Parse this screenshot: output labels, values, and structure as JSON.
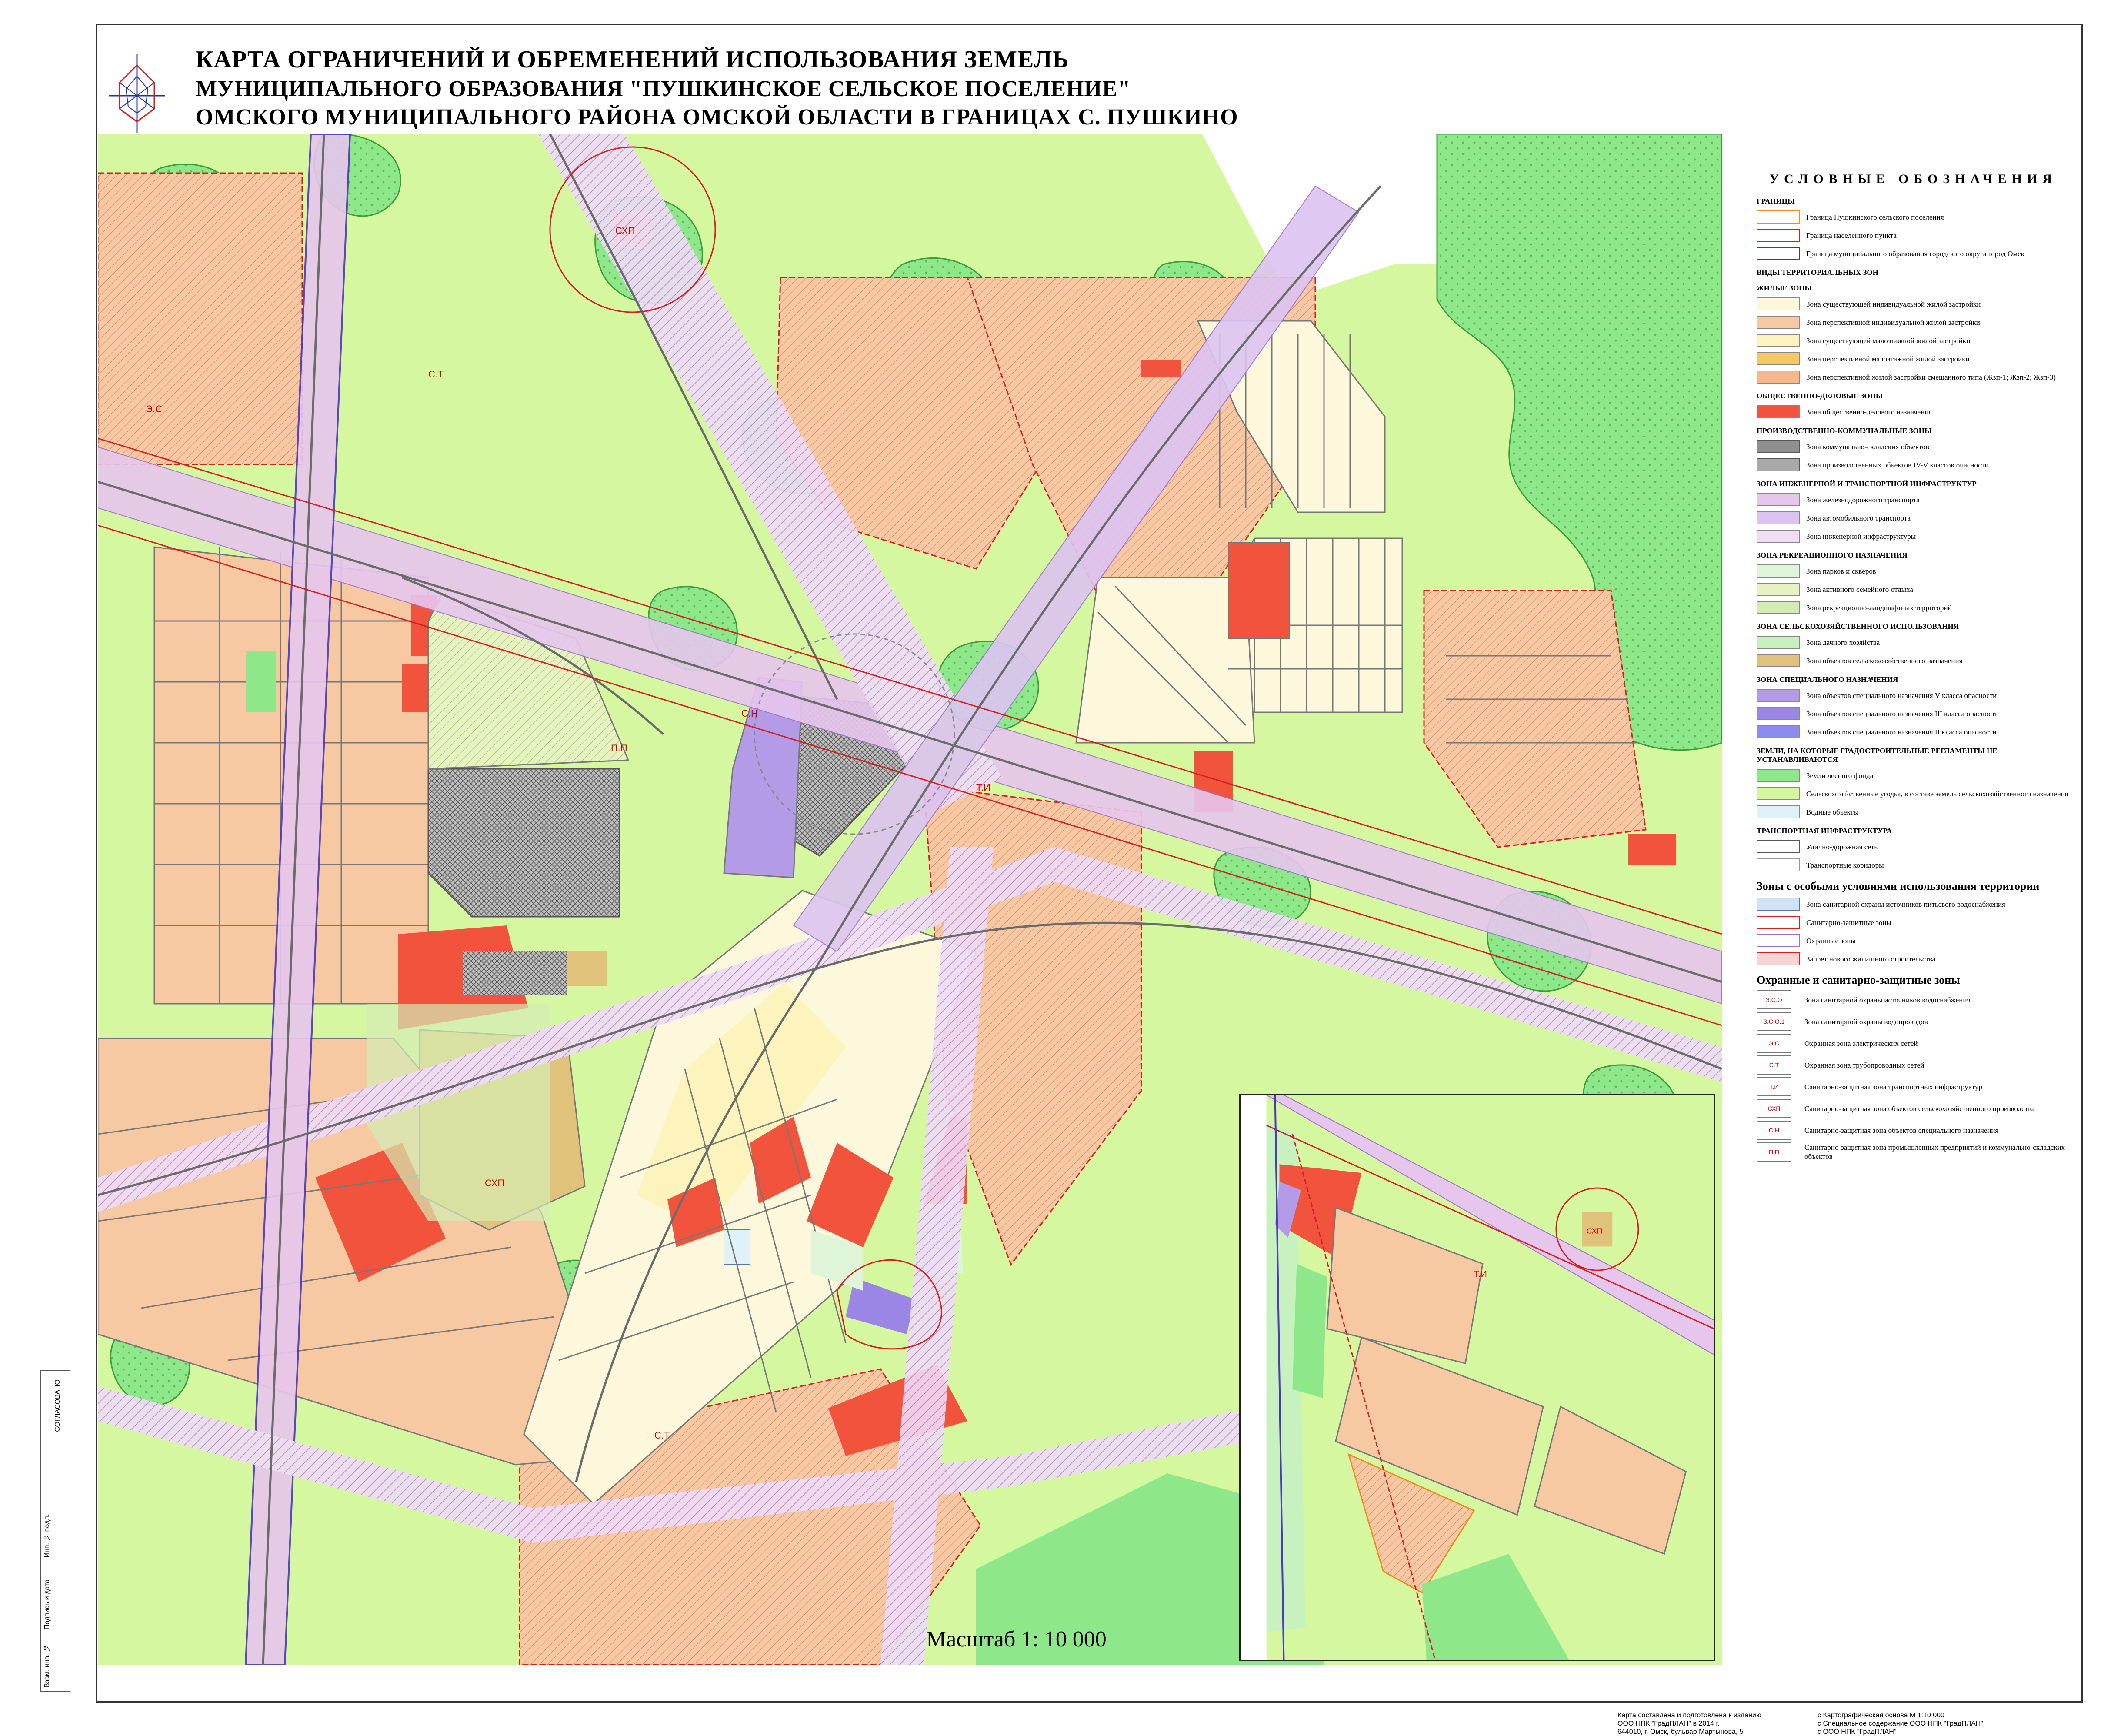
{
  "title": {
    "line1": "КАРТА ОГРАНИЧЕНИЙ И ОБРЕМЕНЕНИЙ ИСПОЛЬЗОВАНИЯ ЗЕМЕЛЬ",
    "line2": "МУНИЦИПАЛЬНОГО ОБРАЗОВАНИЯ \"ПУШКИНСКОЕ СЕЛЬСКОЕ ПОСЕЛЕНИЕ\"",
    "line3": "ОМСКОГО МУНИЦИПАЛЬНОГО РАЙОНА ОМСКОЙ ОБЛАСТИ В ГРАНИЦАХ С. ПУШКИНО"
  },
  "scale": "Масштаб 1: 10 000",
  "map_labels": {
    "skp": "СХП",
    "ti": "Т.И",
    "st": "С.Т",
    "es": "Э.С",
    "sn": "С.Н",
    "pp": "П.П"
  },
  "legend": {
    "title": "УСЛОВНЫЕ ОБОЗНАЧЕНИЯ",
    "sections": [
      {
        "heading": "ГРАНИЦЫ",
        "items": [
          {
            "label": "Граница Пушкинского сельского поселения",
            "fill": "#ffffff",
            "border": "#f08a1a"
          },
          {
            "label": "Граница населенного пункта",
            "fill": "#ffffff",
            "border": "#d21f1f"
          },
          {
            "label": "Граница муниципального образования городского округа город Омск",
            "fill": "#ffffff",
            "border": "#444444"
          }
        ]
      },
      {
        "heading": "ВИДЫ ТЕРРИТОРИАЛЬНЫХ ЗОН",
        "items": []
      },
      {
        "heading": "ЖИЛЫЕ ЗОНЫ",
        "items": [
          {
            "label": "Зона существующей индивидуальной жилой застройки",
            "fill": "#fdf8dc",
            "border": "#888888"
          },
          {
            "label": "Зона перспективной индивидуальной жилой застройки",
            "fill": "#f6c9a3",
            "border": "#888888"
          },
          {
            "label": "Зона существующей малоэтажной жилой застройки",
            "fill": "#fdf3bd",
            "border": "#888888"
          },
          {
            "label": "Зона перспективной малоэтажной жилой застройки",
            "fill": "#f5c765",
            "border": "#888888"
          },
          {
            "label": "Зона перспективной жилой застройки смешанного типа (Жзп-1; Жзп-2; Жзп-3)",
            "fill": "#f8b789",
            "border": "#888888"
          }
        ]
      },
      {
        "heading": "ОБЩЕСТВЕННО-ДЕЛОВЫЕ ЗОНЫ",
        "items": [
          {
            "label": "Зона общественно-делового назначения",
            "fill": "#f2533d",
            "border": "#888888"
          }
        ]
      },
      {
        "heading": "ПРОИЗВОДСТВЕННО-КОММУНАЛЬНЫЕ ЗОНЫ",
        "items": [
          {
            "label": "Зона коммунально-складских объектов",
            "fill": "#8f8f8f",
            "border": "#555555"
          },
          {
            "label": "Зона производственных объектов IV-V классов опасности",
            "fill": "#a9a9a9",
            "border": "#555555"
          }
        ]
      },
      {
        "heading": "ЗОНА ИНЖЕНЕРНОЙ И ТРАНСПОРТНОЙ ИНФРАСТРУКТУР",
        "items": [
          {
            "label": "Зона железнодорожного транспорта",
            "fill": "#e7c6ee",
            "border": "#888888"
          },
          {
            "label": "Зона автомобильного транспорта",
            "fill": "#dcc4f2",
            "border": "#888888"
          },
          {
            "label": "Зона инженерной инфраструктуры",
            "fill": "#efdcf5",
            "border": "#888888"
          }
        ]
      },
      {
        "heading": "ЗОНА РЕКРЕАЦИОННОГО НАЗНАЧЕНИЯ",
        "items": [
          {
            "label": "Зона парков и скверов",
            "fill": "#dff5d8",
            "border": "#888888"
          },
          {
            "label": "Зона активного семейного отдыха",
            "fill": "#e6f2c2",
            "border": "#888888"
          },
          {
            "label": "Зона рекреационно-ландшафтных территорий",
            "fill": "#d4ecb4",
            "border": "#888888"
          }
        ]
      },
      {
        "heading": "ЗОНА СЕЛЬСКОХОЗЯЙСТВЕННОГО ИСПОЛЬЗОВАНИЯ",
        "items": [
          {
            "label": "Зона дачного хозяйства",
            "fill": "#c7f2c0",
            "border": "#888888"
          },
          {
            "label": "Зона объектов сельскохозяйственного назначения",
            "fill": "#e0c27a",
            "border": "#888888"
          }
        ]
      },
      {
        "heading": "ЗОНА СПЕЦИАЛЬНОГО НАЗНАЧЕНИЯ",
        "items": [
          {
            "label": "Зона объектов специального назначения V класса опасности",
            "fill": "#b49be8",
            "border": "#888888"
          },
          {
            "label": "Зона объектов специального назначения III класса опасности",
            "fill": "#9b86e6",
            "border": "#888888"
          },
          {
            "label": "Зона объектов специального назначения II класса опасности",
            "fill": "#8b8cf0",
            "border": "#888888"
          }
        ]
      },
      {
        "heading": "ЗЕМЛИ, НА КОТОРЫЕ ГРАДОСТРОИТЕЛЬНЫЕ РЕГЛАМЕНТЫ НЕ УСТАНАВЛИВАЮТСЯ",
        "items": [
          {
            "label": "Земли лесного фонда",
            "fill": "#8ee88a",
            "border": "#888888"
          },
          {
            "label": "Сельскохозяйственные угодья, в составе земель сельскохозяйственного назначения",
            "fill": "#d5f7a0",
            "border": "#888888"
          },
          {
            "label": "Водные объекты",
            "fill": "#dff2f7",
            "border": "#888888"
          }
        ]
      },
      {
        "heading": "ТРАНСПОРТНАЯ ИНФРАСТРУКТУРА",
        "items": [
          {
            "label": "Улично-дорожная сеть",
            "fill": "#ffffff",
            "border": "#555555"
          },
          {
            "label": "Транспортные коридоры",
            "fill": "#ffffff",
            "border": "#999999"
          }
        ]
      }
    ],
    "special_heading": "Зоны с особыми условиями использования территории",
    "special_items": [
      {
        "label": "Зона санитарной охраны источников питьевого водоснабжения",
        "fill": "#cfe3f5",
        "border": "#5577aa"
      },
      {
        "label": "Санитарно-защитные зоны",
        "fill": "#ffffff",
        "border": "#d21f1f"
      },
      {
        "label": "Охранные зоны",
        "fill": "#ffffff",
        "border": "#9a72c9"
      },
      {
        "label": "Запрет нового жилищного строительства",
        "fill": "#f7d4d4",
        "border": "#d21f1f"
      }
    ],
    "protect_heading": "Охранные и санитарно-защитные зоны",
    "protect_items": [
      {
        "code": "З.С.О",
        "label": "Зона санитарной охраны источников водоснабжения"
      },
      {
        "code": "З.С.О.1",
        "label": "Зона санитарной охраны водопроводов"
      },
      {
        "code": "Э.С",
        "label": "Охранная зона электрических сетей"
      },
      {
        "code": "С.Т",
        "label": "Охранная зона трубопроводных сетей"
      },
      {
        "code": "Т.И",
        "label": "Санитарно-защитная зона транспортных инфраструктур"
      },
      {
        "code": "СХП",
        "label": "Санитарно-защитная зона объектов сельскохозяйственного производства"
      },
      {
        "code": "С.Н",
        "label": "Санитарно-защитная зона объектов специального назначения"
      },
      {
        "code": "П.П",
        "label": "Санитарно-защитная зона промышленных предприятий и коммунально-складских объектов"
      }
    ]
  },
  "stamp": {
    "text": "СОГЛАСОВАНО",
    "rows": [
      "Инв. № подл.",
      "Подпись и дата",
      "Взам. инв. №"
    ]
  },
  "credits": {
    "left": [
      "Карта составлена и подготовлена к изданию",
      "ООО НПК \"ГрадПЛАН\" в 2014 г.",
      "644010, г. Омск, бульвар Мартынова, 5"
    ],
    "right": [
      "с Картографическая основа М 1:10 000",
      "с Специальное содержание ООО НПК \"ГрадПЛАН\"",
      "с ООО НПК \"ГрадПЛАН\""
    ]
  }
}
